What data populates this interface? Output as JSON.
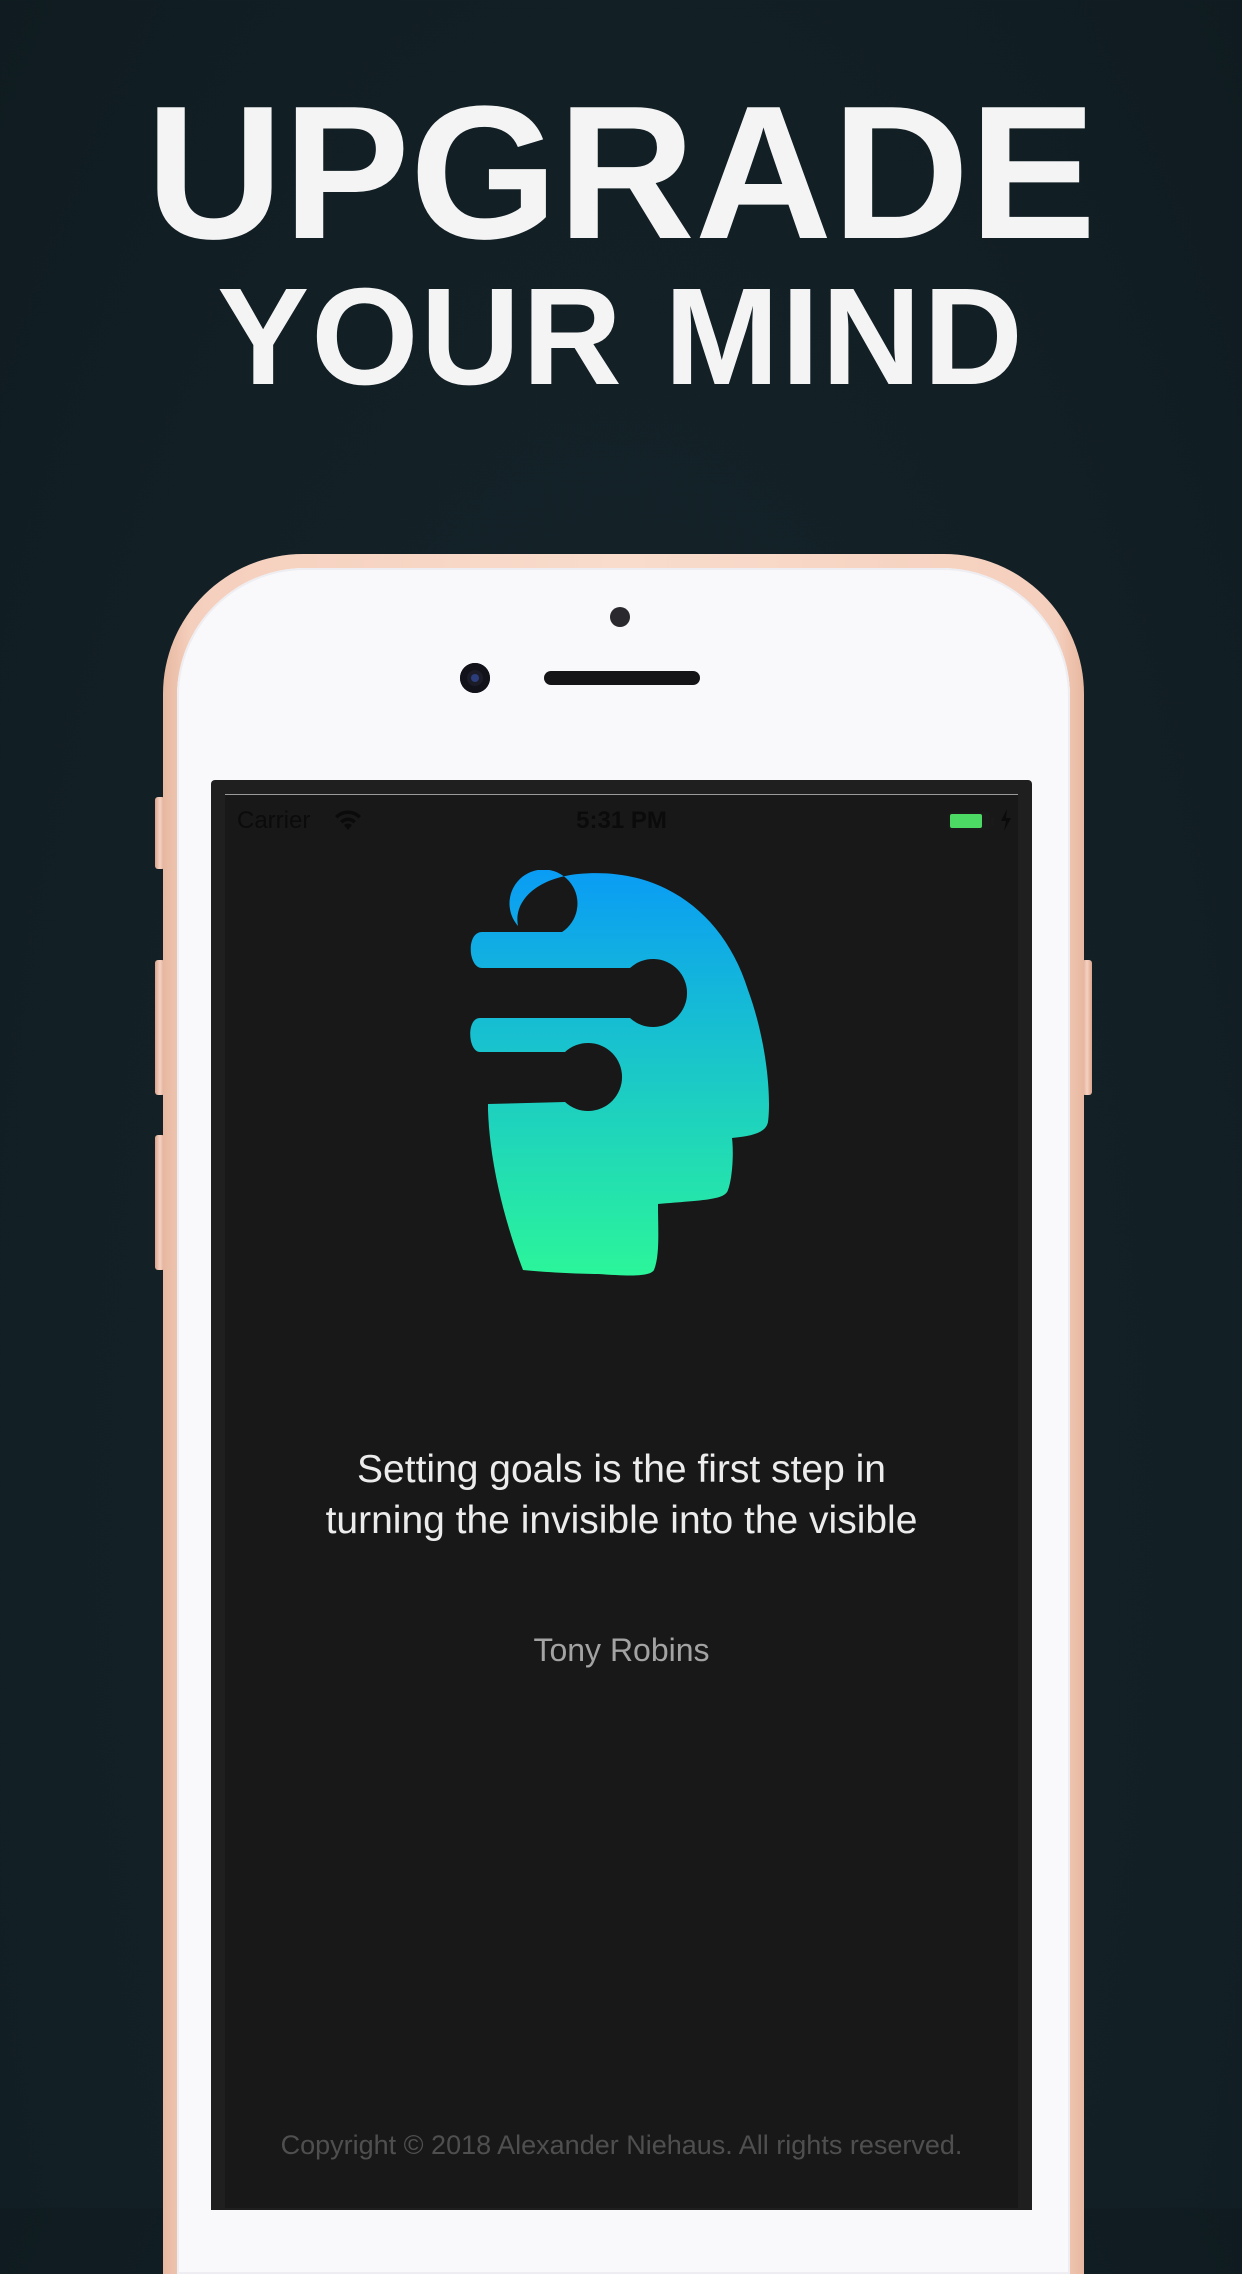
{
  "headline": {
    "line1": "UPGRADE",
    "line2": "YOUR MIND"
  },
  "status_bar": {
    "carrier": "Carrier",
    "time": "5:31 PM",
    "battery_level": 0.85
  },
  "quote": {
    "line1": "Setting goals is the first step in",
    "line2": "turning the invisible into the visible",
    "author": "Tony Robins"
  },
  "footer": {
    "copyright": "Copyright © 2018 Alexander Niehaus. All rights reserved."
  },
  "colors": {
    "background": "#132127",
    "headline": "#f4f4f4",
    "screen": "#181818",
    "logo_gradient_top": "#0a9cf5",
    "logo_gradient_bottom": "#2bf59a",
    "phone_frame": "#f5cfbd",
    "battery": "#4cd964"
  }
}
